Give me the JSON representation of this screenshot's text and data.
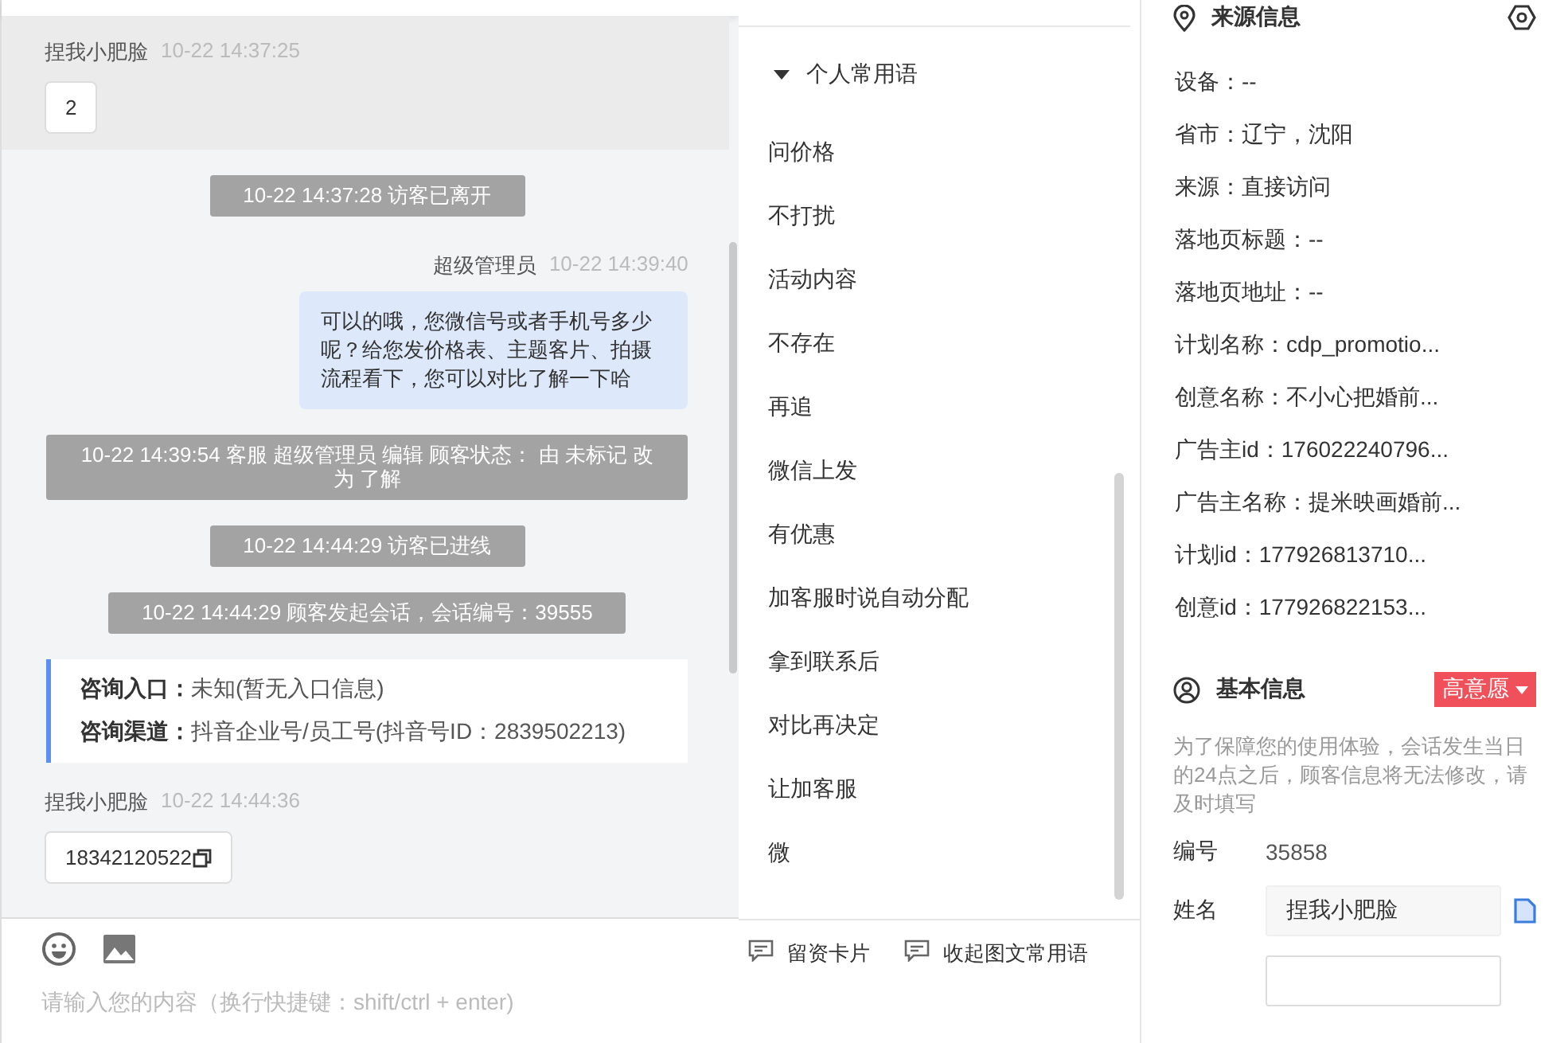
{
  "chat": {
    "messages": [
      {
        "kind": "customer",
        "name": "捏我小肥脸",
        "time": "10-22 14:37:25",
        "content": "2",
        "highlighted": true,
        "copyable": false
      },
      {
        "kind": "system",
        "text": "10-22 14:37:28 访客已离开"
      },
      {
        "kind": "agent",
        "name": "超级管理员",
        "time": "10-22 14:39:40",
        "text": "可以的哦，您微信号或者手机号多少呢？给您发价格表、主题客片、拍摄流程看下，您可以对比了解一下哈"
      },
      {
        "kind": "system",
        "text": "10-22 14:39:54 客服 超级管理员 编辑 顾客状态： 由 未标记 改为 了解"
      },
      {
        "kind": "system",
        "text": "10-22 14:44:29 访客已进线"
      },
      {
        "kind": "system",
        "text": "10-22 14:44:29 顾客发起会话，会话编号：39555"
      },
      {
        "kind": "info",
        "rows": [
          {
            "label": "咨询入口：",
            "value": "未知(暂无入口信息)"
          },
          {
            "label": "咨询渠道：",
            "value": "抖音企业号/员工号(抖音号ID：2839502213)"
          }
        ]
      },
      {
        "kind": "customer",
        "name": "捏我小肥脸",
        "time": "10-22 14:44:36",
        "content": "18342120522",
        "highlighted": false,
        "copyable": true
      }
    ],
    "input": {
      "placeholder": "请输入您的内容（换行快捷键：shift/ctrl + enter)"
    }
  },
  "phrases": {
    "group": {
      "label": "个人常用语",
      "expanded": true
    },
    "items": [
      "问价格",
      "不打扰",
      "活动内容",
      "不存在",
      "再追",
      "微信上发",
      "有优惠",
      "加客服时说自动分配",
      "拿到联系后",
      "对比再决定",
      "让加客服",
      "微"
    ],
    "actions": [
      "留资卡片",
      "收起图文常用语"
    ]
  },
  "source_info": {
    "title": "来源信息",
    "fields": [
      "设备：--",
      "省市：辽宁，沈阳",
      "来源：直接访问",
      "落地页标题：--",
      "落地页地址：--",
      "计划名称：cdp_promotio...",
      "创意名称：不小心把婚前...",
      "广告主id：176022240796...",
      "广告主名称：提米映画婚前...",
      "计划id：177926813710...",
      "创意id：177926822153..."
    ]
  },
  "basic_info": {
    "title": "基本信息",
    "intent": "高意愿",
    "note": "为了保障您的使用体验，会话发生当日的24点之后，顾客信息将无法修改，请及时填写",
    "fields": [
      {
        "kind": "text",
        "label": "编号",
        "value": "35858"
      },
      {
        "kind": "input",
        "label": "姓名",
        "value": "捏我小肥脸",
        "copyable": true
      },
      {
        "kind": "input"
      }
    ]
  }
}
